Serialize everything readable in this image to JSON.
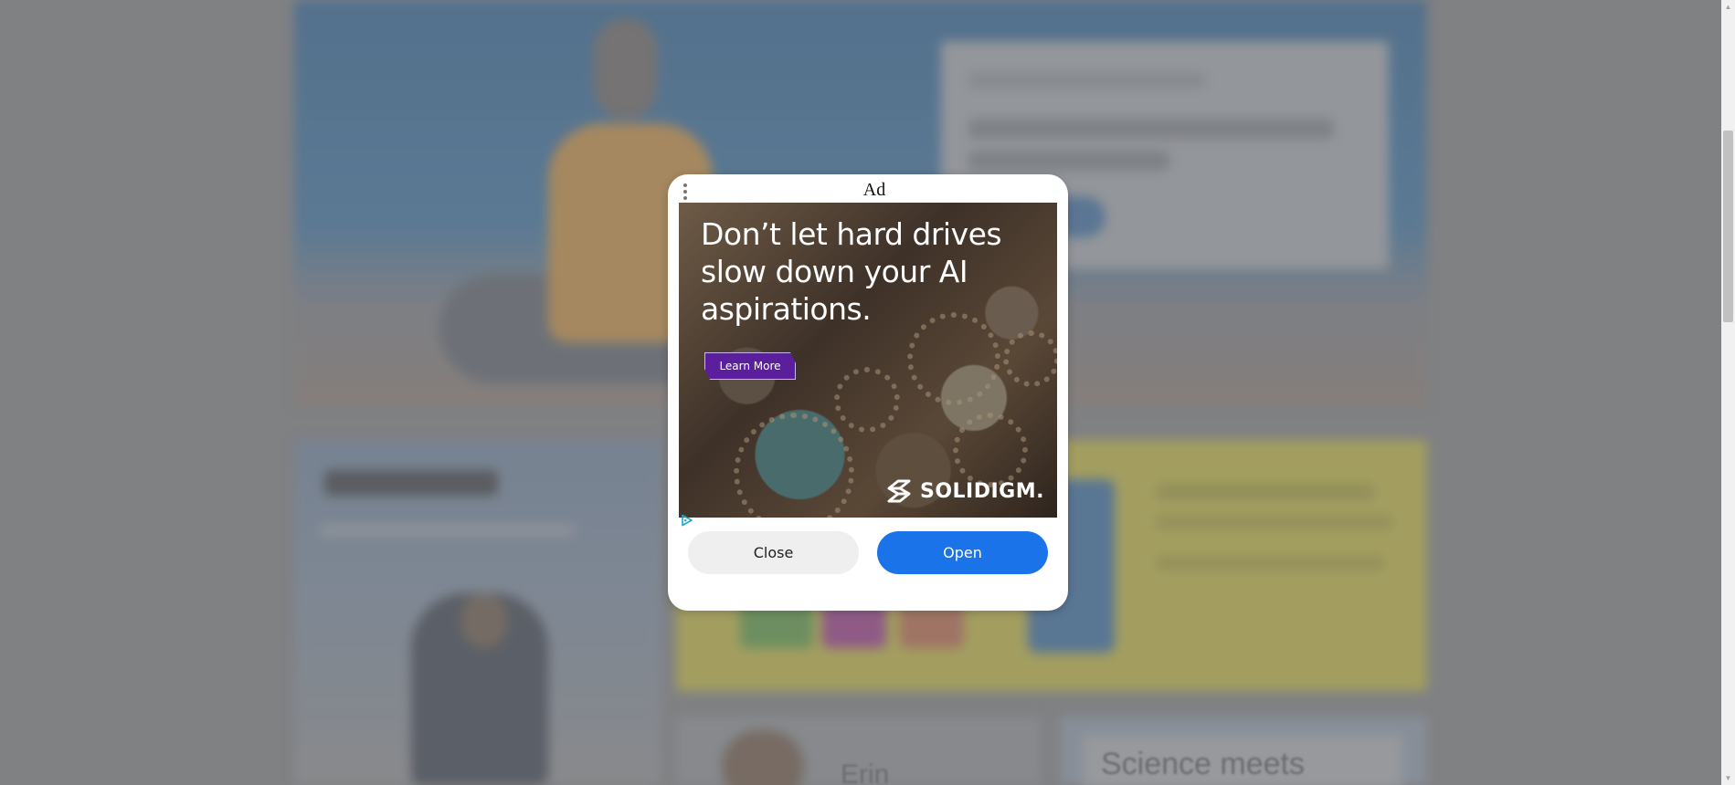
{
  "modal": {
    "title": "Ad",
    "close_label": "Close",
    "open_label": "Open"
  },
  "ad": {
    "headline": "Don’t let hard drives slow down your AI aspirations.",
    "cta_label": "Learn More",
    "brand": "SOLIDIGM.",
    "accent_color": "#5b1f9e"
  },
  "background": {
    "visible_text_1": "Erin",
    "visible_text_2": "Science meets"
  },
  "colors": {
    "open_button": "#1a73e8",
    "close_button": "#efefef",
    "overlay": "rgba(128,128,128,0.45)"
  },
  "icons": {
    "menu": "vertical-dots-icon",
    "adchoices": "adchoices-icon",
    "brand_logo": "solidigm-logo-icon"
  }
}
